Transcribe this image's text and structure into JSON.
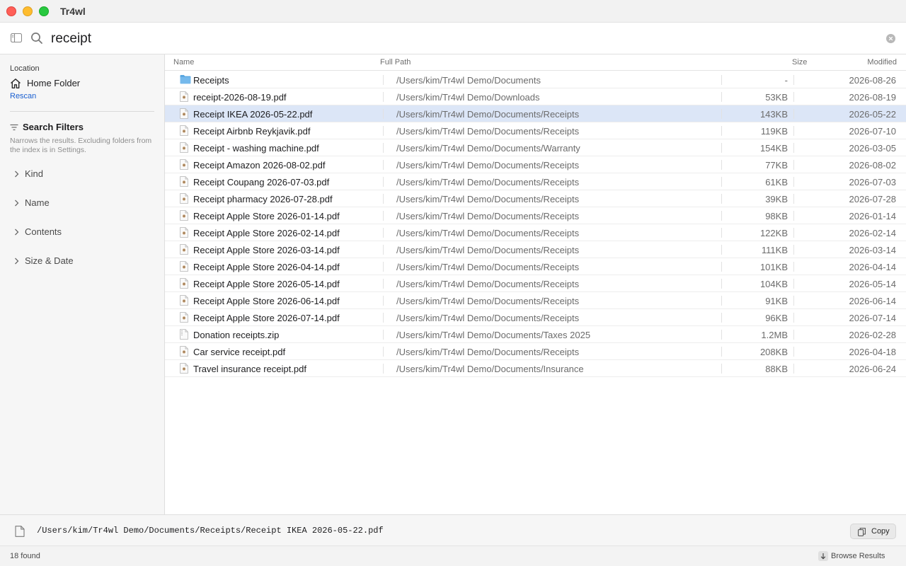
{
  "window": {
    "title": "Tr4wl"
  },
  "search": {
    "query": "receipt",
    "placeholder": ""
  },
  "sidebar": {
    "location_label": "Location",
    "location_value": "Home Folder",
    "rescan_label": "Rescan",
    "filters_title": "Search Filters",
    "filters_description": "Narrows the results. Excluding folders from the index is in Settings.",
    "filters": [
      {
        "label": "Kind"
      },
      {
        "label": "Name"
      },
      {
        "label": "Contents"
      },
      {
        "label": "Size & Date"
      }
    ]
  },
  "table": {
    "columns": {
      "name": "Name",
      "path": "Full Path",
      "size": "Size",
      "modified": "Modified"
    },
    "selected_index": 2,
    "rows": [
      {
        "icon": "folder-icon",
        "name": "Receipts",
        "path": "/Users/kim/Tr4wl Demo/Documents",
        "size": "-",
        "modified": "2026-08-26"
      },
      {
        "icon": "pdf-file-icon",
        "name": "receipt-2026-08-19.pdf",
        "path": "/Users/kim/Tr4wl Demo/Downloads",
        "size": "53KB",
        "modified": "2026-08-19"
      },
      {
        "icon": "pdf-file-icon",
        "name": "Receipt IKEA 2026-05-22.pdf",
        "path": "/Users/kim/Tr4wl Demo/Documents/Receipts",
        "size": "143KB",
        "modified": "2026-05-22"
      },
      {
        "icon": "pdf-file-icon",
        "name": "Receipt Airbnb Reykjavik.pdf",
        "path": "/Users/kim/Tr4wl Demo/Documents/Receipts",
        "size": "119KB",
        "modified": "2026-07-10"
      },
      {
        "icon": "pdf-file-icon",
        "name": "Receipt - washing machine.pdf",
        "path": "/Users/kim/Tr4wl Demo/Documents/Warranty",
        "size": "154KB",
        "modified": "2026-03-05"
      },
      {
        "icon": "pdf-file-icon",
        "name": "Receipt Amazon 2026-08-02.pdf",
        "path": "/Users/kim/Tr4wl Demo/Documents/Receipts",
        "size": "77KB",
        "modified": "2026-08-02"
      },
      {
        "icon": "pdf-file-icon",
        "name": "Receipt Coupang 2026-07-03.pdf",
        "path": "/Users/kim/Tr4wl Demo/Documents/Receipts",
        "size": "61KB",
        "modified": "2026-07-03"
      },
      {
        "icon": "pdf-file-icon",
        "name": "Receipt pharmacy 2026-07-28.pdf",
        "path": "/Users/kim/Tr4wl Demo/Documents/Receipts",
        "size": "39KB",
        "modified": "2026-07-28"
      },
      {
        "icon": "pdf-file-icon",
        "name": "Receipt Apple Store 2026-01-14.pdf",
        "path": "/Users/kim/Tr4wl Demo/Documents/Receipts",
        "size": "98KB",
        "modified": "2026-01-14"
      },
      {
        "icon": "pdf-file-icon",
        "name": "Receipt Apple Store 2026-02-14.pdf",
        "path": "/Users/kim/Tr4wl Demo/Documents/Receipts",
        "size": "122KB",
        "modified": "2026-02-14"
      },
      {
        "icon": "pdf-file-icon",
        "name": "Receipt Apple Store 2026-03-14.pdf",
        "path": "/Users/kim/Tr4wl Demo/Documents/Receipts",
        "size": "111KB",
        "modified": "2026-03-14"
      },
      {
        "icon": "pdf-file-icon",
        "name": "Receipt Apple Store 2026-04-14.pdf",
        "path": "/Users/kim/Tr4wl Demo/Documents/Receipts",
        "size": "101KB",
        "modified": "2026-04-14"
      },
      {
        "icon": "pdf-file-icon",
        "name": "Receipt Apple Store 2026-05-14.pdf",
        "path": "/Users/kim/Tr4wl Demo/Documents/Receipts",
        "size": "104KB",
        "modified": "2026-05-14"
      },
      {
        "icon": "pdf-file-icon",
        "name": "Receipt Apple Store 2026-06-14.pdf",
        "path": "/Users/kim/Tr4wl Demo/Documents/Receipts",
        "size": "91KB",
        "modified": "2026-06-14"
      },
      {
        "icon": "pdf-file-icon",
        "name": "Receipt Apple Store 2026-07-14.pdf",
        "path": "/Users/kim/Tr4wl Demo/Documents/Receipts",
        "size": "96KB",
        "modified": "2026-07-14"
      },
      {
        "icon": "zip-file-icon",
        "name": "Donation receipts.zip",
        "path": "/Users/kim/Tr4wl Demo/Documents/Taxes 2025",
        "size": "1.2MB",
        "modified": "2026-02-28"
      },
      {
        "icon": "pdf-file-icon",
        "name": "Car service receipt.pdf",
        "path": "/Users/kim/Tr4wl Demo/Documents/Receipts",
        "size": "208KB",
        "modified": "2026-04-18"
      },
      {
        "icon": "pdf-file-icon",
        "name": "Travel insurance receipt.pdf",
        "path": "/Users/kim/Tr4wl Demo/Documents/Insurance",
        "size": "88KB",
        "modified": "2026-06-24"
      }
    ]
  },
  "pathbar": {
    "path": "/Users/kim/Tr4wl Demo/Documents/Receipts/Receipt IKEA 2026-05-22.pdf",
    "copy_label": "Copy"
  },
  "status": {
    "found_text": "18 found",
    "browse_label": "Browse Results"
  },
  "colors": {
    "accent": "#1a5fd0",
    "selection": "#dce6f7",
    "folder": "#5aa7e0"
  }
}
